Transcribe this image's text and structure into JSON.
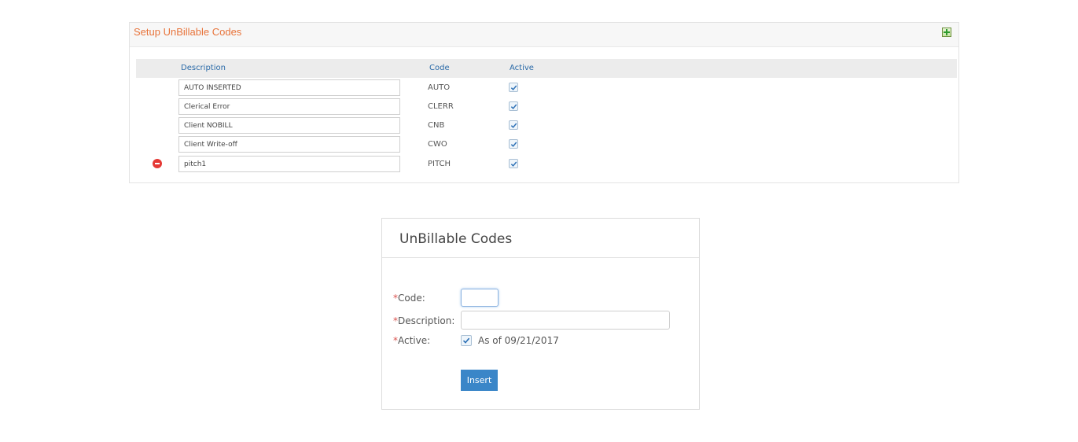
{
  "panel": {
    "title": "Setup UnBillable Codes",
    "add_icon": "add-icon",
    "columns": {
      "description": "Description",
      "code": "Code",
      "active": "Active"
    },
    "rows": [
      {
        "description": "AUTO INSERTED",
        "code": "AUTO",
        "active": true
      },
      {
        "description": "Clerical Error",
        "code": "CLERR",
        "active": true
      },
      {
        "description": "Client NOBILL",
        "code": "CNB",
        "active": true
      },
      {
        "description": "Client Write-off",
        "code": "CWO",
        "active": true
      },
      {
        "description": "pitch1",
        "code": "PITCH",
        "active": true,
        "deletable": true
      }
    ]
  },
  "dialog": {
    "title": "UnBillable Codes",
    "required_marker": "*",
    "code_label": "Code:",
    "code_value": "",
    "description_label": "Description:",
    "description_value": "",
    "active_label": "Active:",
    "active_checked": true,
    "as_of_prefix": "As of",
    "as_of_date": "09/21/2017",
    "insert_label": "Insert"
  },
  "colors": {
    "title_orange": "#e8743b",
    "header_blue": "#2a6aa8",
    "button_blue": "#3a86c8",
    "delete_red": "#e53935",
    "required_red": "#d9534f"
  }
}
